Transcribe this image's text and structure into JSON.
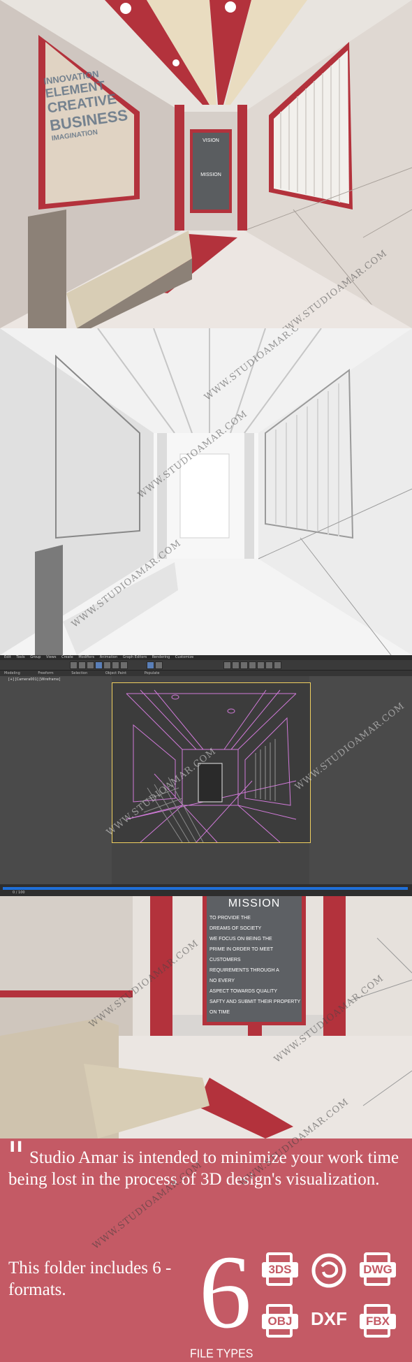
{
  "render_top": {
    "sign_vision": "VISION",
    "sign_mission": "MISSION",
    "wall_words": [
      "INNOVATION",
      "ELEMENT",
      "CREATIVE",
      "BUSINESS",
      "IMAGINATION"
    ]
  },
  "max_ui": {
    "menu_items": [
      "Edit",
      "Tools",
      "Group",
      "Views",
      "Create",
      "Modifiers",
      "Animation",
      "Graph Editors",
      "Rendering",
      "Customize"
    ],
    "ribbon_tabs": [
      "Modeling",
      "Freeform",
      "Selection",
      "Object Paint",
      "Populate"
    ],
    "viewport_label": "[+] [Camera001] [Wireframe]",
    "timeline_label": "0 / 100"
  },
  "render_bottom": {
    "mission_title": "MISSION",
    "mission_lines": [
      "TO PROVIDE THE",
      "DREAMS OF SOCIETY",
      "WE FOCUS ON BEING THE",
      "PRIME IN ORDER TO MEET",
      "CUSTOMERS",
      "REQUIREMENTS THROUGH A",
      "NO EVERY",
      "ASPECT TOWARDS QUALITY",
      "SAFTY AND SUBMIT THEIR PROPERTY",
      "ON TIME"
    ]
  },
  "watermark": "WWW.STUDIOAMAR.COM",
  "banner": {
    "quote_mark": "\"",
    "tagline": "Studio Amar is intended to minimize your work time being lost in the process of 3D design's visualization.",
    "folder_text": "This folder includes 6 - formats.",
    "big_number": "6",
    "file_types_label": "FILE TYPES",
    "formats": [
      "3DS",
      "MAX",
      "DWG",
      "OBJ",
      "DXF",
      "FBX"
    ]
  },
  "colors": {
    "accent_red": "#b3323c",
    "banner": "#c45a65",
    "wireframe": "#d07ad8"
  }
}
